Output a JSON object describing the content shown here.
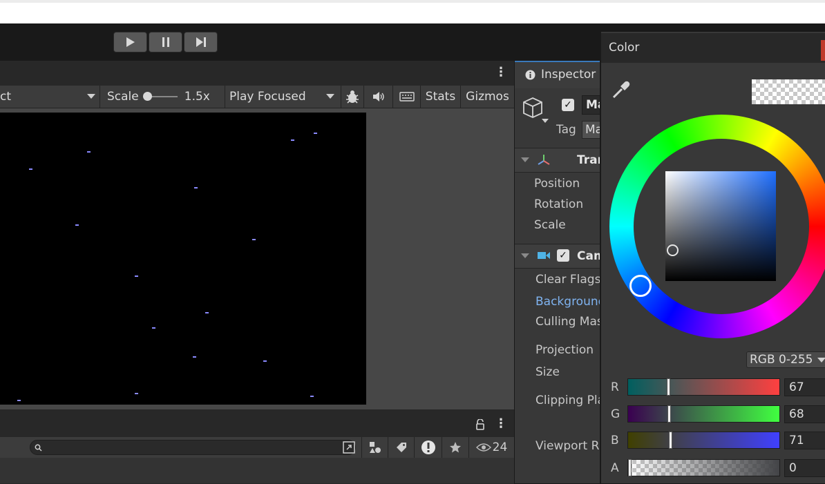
{
  "toolbar": {
    "play_icon": "play-icon",
    "pause_icon": "pause-icon",
    "step_icon": "step-icon"
  },
  "game_view": {
    "display_select": "ct",
    "scale_label": "Scale",
    "scale_value": "1.5x",
    "play_mode": "Play Focused",
    "stats_label": "Stats",
    "gizmos_label": "Gizmos"
  },
  "bottom_panel": {
    "hidden_count": "24"
  },
  "inspector": {
    "tab_label": "Inspector",
    "object_name": "Ma",
    "tag_label": "Tag",
    "tag_value": "Ma",
    "transform": {
      "title": "Tran",
      "fields": [
        "Position",
        "Rotation",
        "Scale"
      ]
    },
    "camera": {
      "title": "Cam",
      "fields": {
        "clear_flags": "Clear Flags",
        "background": "Background",
        "culling_mask": "Culling Mas",
        "projection": "Projection",
        "size": "Size",
        "clipping": "Clipping Pla",
        "viewport": "Viewport R"
      }
    }
  },
  "color_picker": {
    "title": "Color",
    "mode": "RGB 0-255",
    "channels": [
      {
        "label": "R",
        "value": "67",
        "fraction": 0.263
      },
      {
        "label": "G",
        "value": "68",
        "fraction": 0.267
      },
      {
        "label": "B",
        "value": "71",
        "fraction": 0.278
      },
      {
        "label": "A",
        "value": "0",
        "fraction": 0.0
      }
    ],
    "colors": {
      "accent": "#3a79bb",
      "background_link": "#7fb3f0",
      "close_red": "#c0392b"
    }
  }
}
